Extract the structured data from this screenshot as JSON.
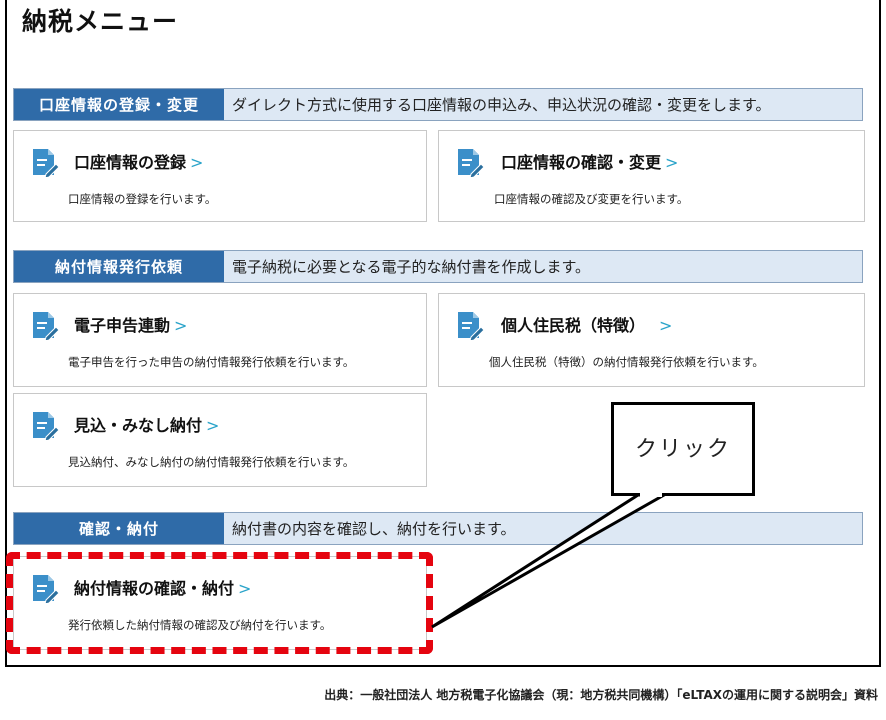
{
  "page_title": "納税メニュー",
  "sections": [
    {
      "tab": "口座情報の登録・変更",
      "desc": "ダイレクト方式に使用する口座情報の申込み、申込状況の確認・変更をします。"
    },
    {
      "tab": "納付情報発行依頼",
      "desc": "電子納税に必要となる電子的な納付書を作成します。"
    },
    {
      "tab": "確認・納付",
      "desc": "納付書の内容を確認し、納付を行います。"
    }
  ],
  "cards": [
    {
      "title": "口座情報の登録",
      "desc": "口座情報の登録を行います。"
    },
    {
      "title": "口座情報の確認・変更",
      "desc": "口座情報の確認及び変更を行います。"
    },
    {
      "title": "電子申告連動",
      "desc": "電子申告を行った申告の納付情報発行依頼を行います。"
    },
    {
      "title": "個人住民税（特徴）",
      "desc": "個人住民税（特徴）の納付情報発行依頼を行います。"
    },
    {
      "title": "見込・みなし納付",
      "desc": "見込納付、みなし納付の納付情報発行依頼を行います。"
    },
    {
      "title": "納付情報の確認・納付",
      "desc": "発行依頼した納付情報の確認及び納付を行います。"
    }
  ],
  "chevron": ">",
  "callout": "クリック",
  "footer": "出典：一般社団法人 地方税電子化協議会（現：地方税共同機構）「eLTAXの運用に関する説明会」資料",
  "colors": {
    "tab_blue": "#2f6ba8",
    "bar_light": "#dde8f4",
    "highlight_red": "#e5040f",
    "chevron_teal": "#29a3c9",
    "icon_blue": "#3b8fc9"
  },
  "icon": "document-pen-icon"
}
